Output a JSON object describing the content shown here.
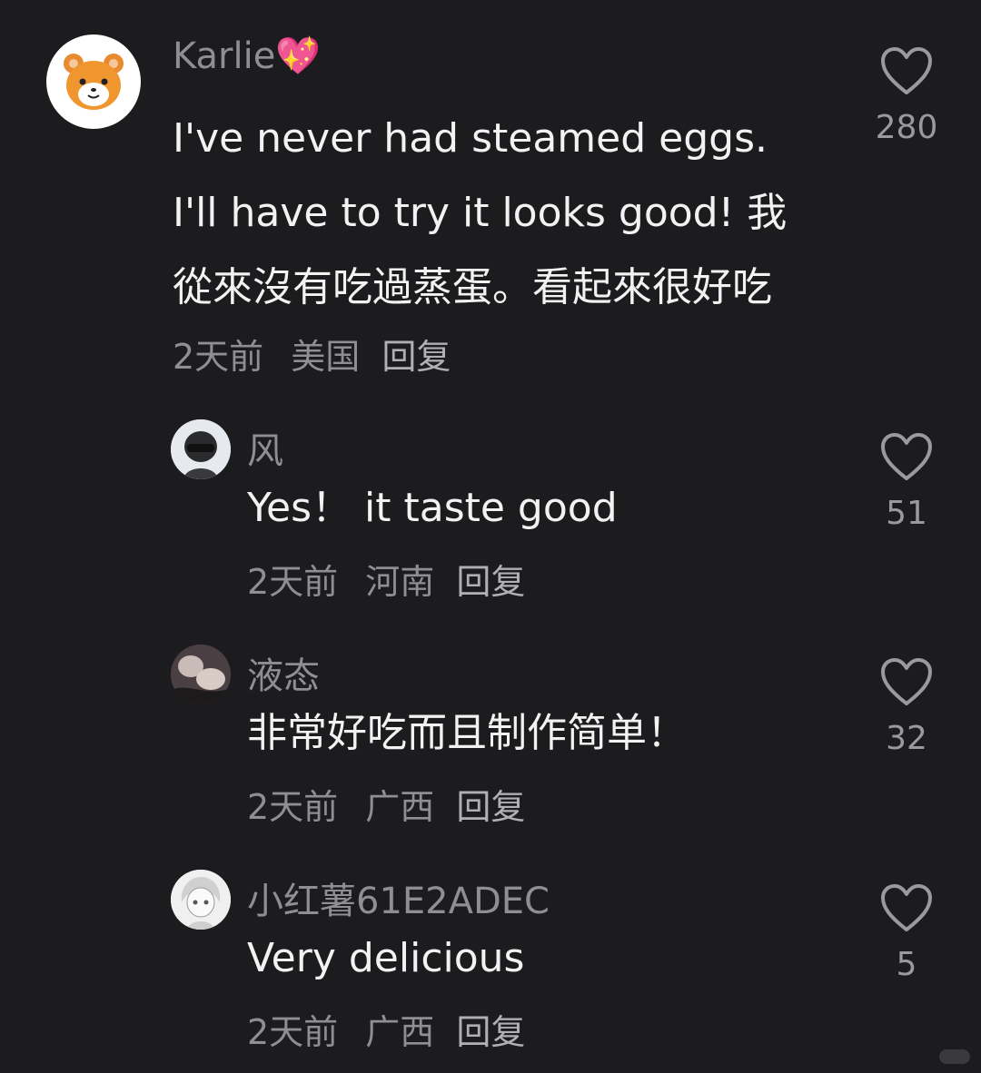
{
  "comments": [
    {
      "username": "Karlie",
      "emoji": "💖",
      "text": "I've never had steamed eggs. I'll have to try it looks good! 我從來沒有吃過蒸蛋。看起來很好吃",
      "time": "2天前",
      "location": "美国",
      "reply_label": "回复",
      "likes": "280",
      "avatar_icon": "hamster-avatar-icon"
    },
    {
      "username": "风",
      "text": "Yes！ it taste good",
      "time": "2天前",
      "location": "河南",
      "reply_label": "回复",
      "likes": "51",
      "avatar_icon": "helmet-person-avatar-icon"
    },
    {
      "username": "液态",
      "text": "非常好吃而且制作简单！",
      "time": "2天前",
      "location": "广西",
      "reply_label": "回复",
      "likes": "32",
      "avatar_icon": "photo-avatar-icon"
    },
    {
      "username": "小红薯61E2ADEC",
      "text": "Very delicious",
      "time": "2天前",
      "location": "广西",
      "reply_label": "回复",
      "likes": "5",
      "avatar_icon": "anime-avatar-icon"
    }
  ],
  "colors": {
    "background": "#1c1c1f",
    "username": "#8e8e93",
    "text": "#f2f2f2",
    "heart": "#9a9a9e"
  }
}
